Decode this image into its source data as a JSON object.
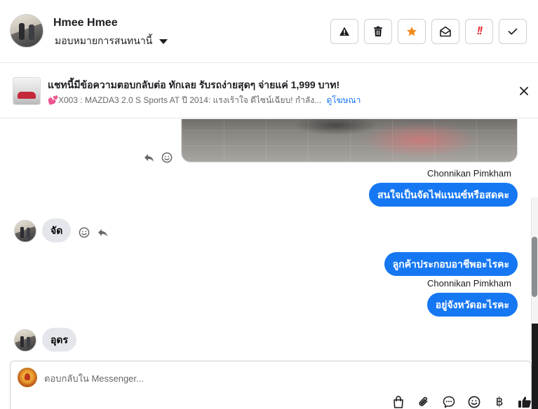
{
  "header": {
    "name": "Hmee Hmee",
    "assign_label": "มอบหมายการสนทนานี้",
    "toolbar": {
      "report": "warning-icon",
      "delete": "trash-icon",
      "star": "star-icon",
      "mark_unread": "envelope-open-icon",
      "urgent": "!!",
      "done": "check-icon"
    },
    "colors": {
      "star": "#f28b1f",
      "urgent": "#e4282d"
    }
  },
  "ad": {
    "title": "แชทนี้มีข้อความตอบกลับต่อ ทักเลย รับรถง่ายสุดๆ จ่ายแค่ 1,999 บาท!",
    "description": "💕X003 : MAZDA3 2.0 S Sports AT ปี 2014: แรงเร้าใจ ดีไซน์เฉียบ! กำลัง...",
    "link_label": "ดูโฆษณา"
  },
  "messages": [
    {
      "sender": "Chonnikan Pimkham",
      "direction": "out",
      "text": "สนใจเป็นจัดไฟแนนซ์หรือสดคะ"
    },
    {
      "direction": "in",
      "text": "จัด"
    },
    {
      "direction": "out",
      "text": "ลูกค้าประกอบอาชีพอะไรคะ"
    },
    {
      "sender": "Chonnikan Pimkham",
      "direction": "out",
      "text": "อยู่จังหวัดอะไรคะ"
    },
    {
      "direction": "in",
      "text": "อุดร"
    }
  ],
  "composer": {
    "placeholder": "ตอบกลับใน Messenger...",
    "tools": [
      "bag-icon",
      "paperclip-icon",
      "chat-bubble-icon",
      "emoji-icon",
      "baht-icon",
      "thumbs-up-icon"
    ],
    "baht_symbol": "฿"
  },
  "colors": {
    "accent": "#1677f2",
    "incoming_bubble": "#e4e6eb"
  }
}
